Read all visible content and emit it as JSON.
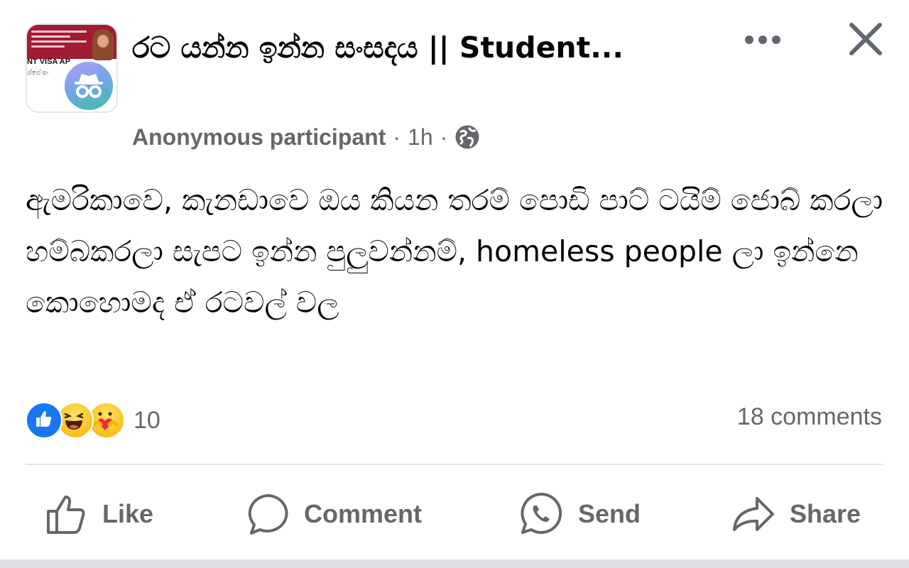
{
  "colors": {
    "text_primary": "#050505",
    "text_secondary": "#65676b",
    "divider": "#e4e6eb",
    "like_blue": "#1877f2"
  },
  "header": {
    "group_name": "රට යන්න ඉන්න සංසදය || Student...",
    "group_thumbnail_text": "NT VISA AP",
    "group_thumbnail_subtext": "ග්ගේ සං",
    "avatar_icon": "anonymous-incognito-icon",
    "author": "Anonymous participant",
    "separator": "·",
    "time": "1h",
    "privacy_icon": "globe-icon"
  },
  "post": {
    "text": "ඇමරිකාවෙ, කැනඩාවෙ ඔය කියන තරම් පොඩි පාට් ටයිම් ජොබ් කරලා හම්බකරලා සැපට ඉන්න පුලුවන්නම්, homeless people ලා ඉන්නෙ කොහොමද ඒ රටවල් වල"
  },
  "reactions": {
    "icons": [
      "like-reaction-icon",
      "haha-reaction-icon",
      "care-reaction-icon"
    ],
    "count": "10",
    "comments": "18 comments"
  },
  "actions": {
    "like": "Like",
    "comment": "Comment",
    "send": "Send",
    "share": "Share"
  }
}
